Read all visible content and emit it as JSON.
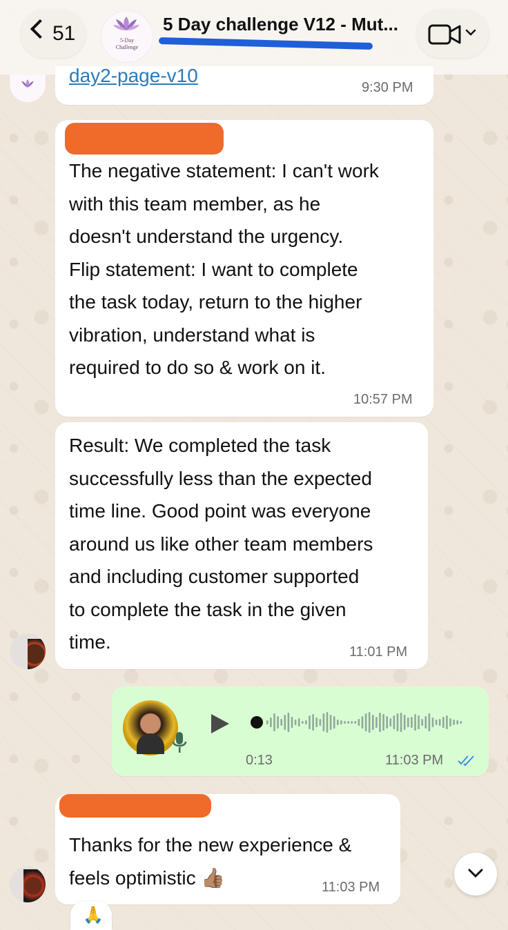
{
  "header": {
    "back_count": "51",
    "avatar_line1": "5-Day",
    "avatar_line2": "Challenge",
    "title": "5 Day challenge V12 - Mut..."
  },
  "messages": [
    {
      "id": "link",
      "text": "day2-page-v10",
      "time": "9:30 PM"
    },
    {
      "id": "m1",
      "text": "The negative statement: I can't work\nwith this team member, as he\ndoesn't understand the urgency.\nFlip statement: I want to complete\nthe task today, return to the higher\nvibration, understand what is\nrequired to do so & work on it.",
      "time": "10:57 PM"
    },
    {
      "id": "m2",
      "text": "Result: We completed the task\nsuccessfully less than the expected\ntime line. Good point was everyone\naround us like other team members\nand including customer supported\nto complete the task in the given\ntime.",
      "time": "11:01 PM"
    },
    {
      "id": "voice",
      "duration": "0:13",
      "time": "11:03 PM",
      "progress": 0
    },
    {
      "id": "m4",
      "text": "Thanks for the new experience &\nfeels optimistic 👍🏽",
      "time": "11:03 PM"
    }
  ],
  "reaction": "🙏",
  "colors": {
    "outgoing_bubble": "#d9fdd3",
    "incoming_bubble": "#ffffff",
    "read_ticks": "#3a8ee6",
    "redaction": "#f06a2a",
    "subtitle_redaction": "#1f5fd8"
  },
  "icons": [
    "chevron-left-icon",
    "lotus-icon",
    "video-camera-icon",
    "chevron-down-icon",
    "play-icon",
    "microphone-icon",
    "double-check-icon"
  ]
}
